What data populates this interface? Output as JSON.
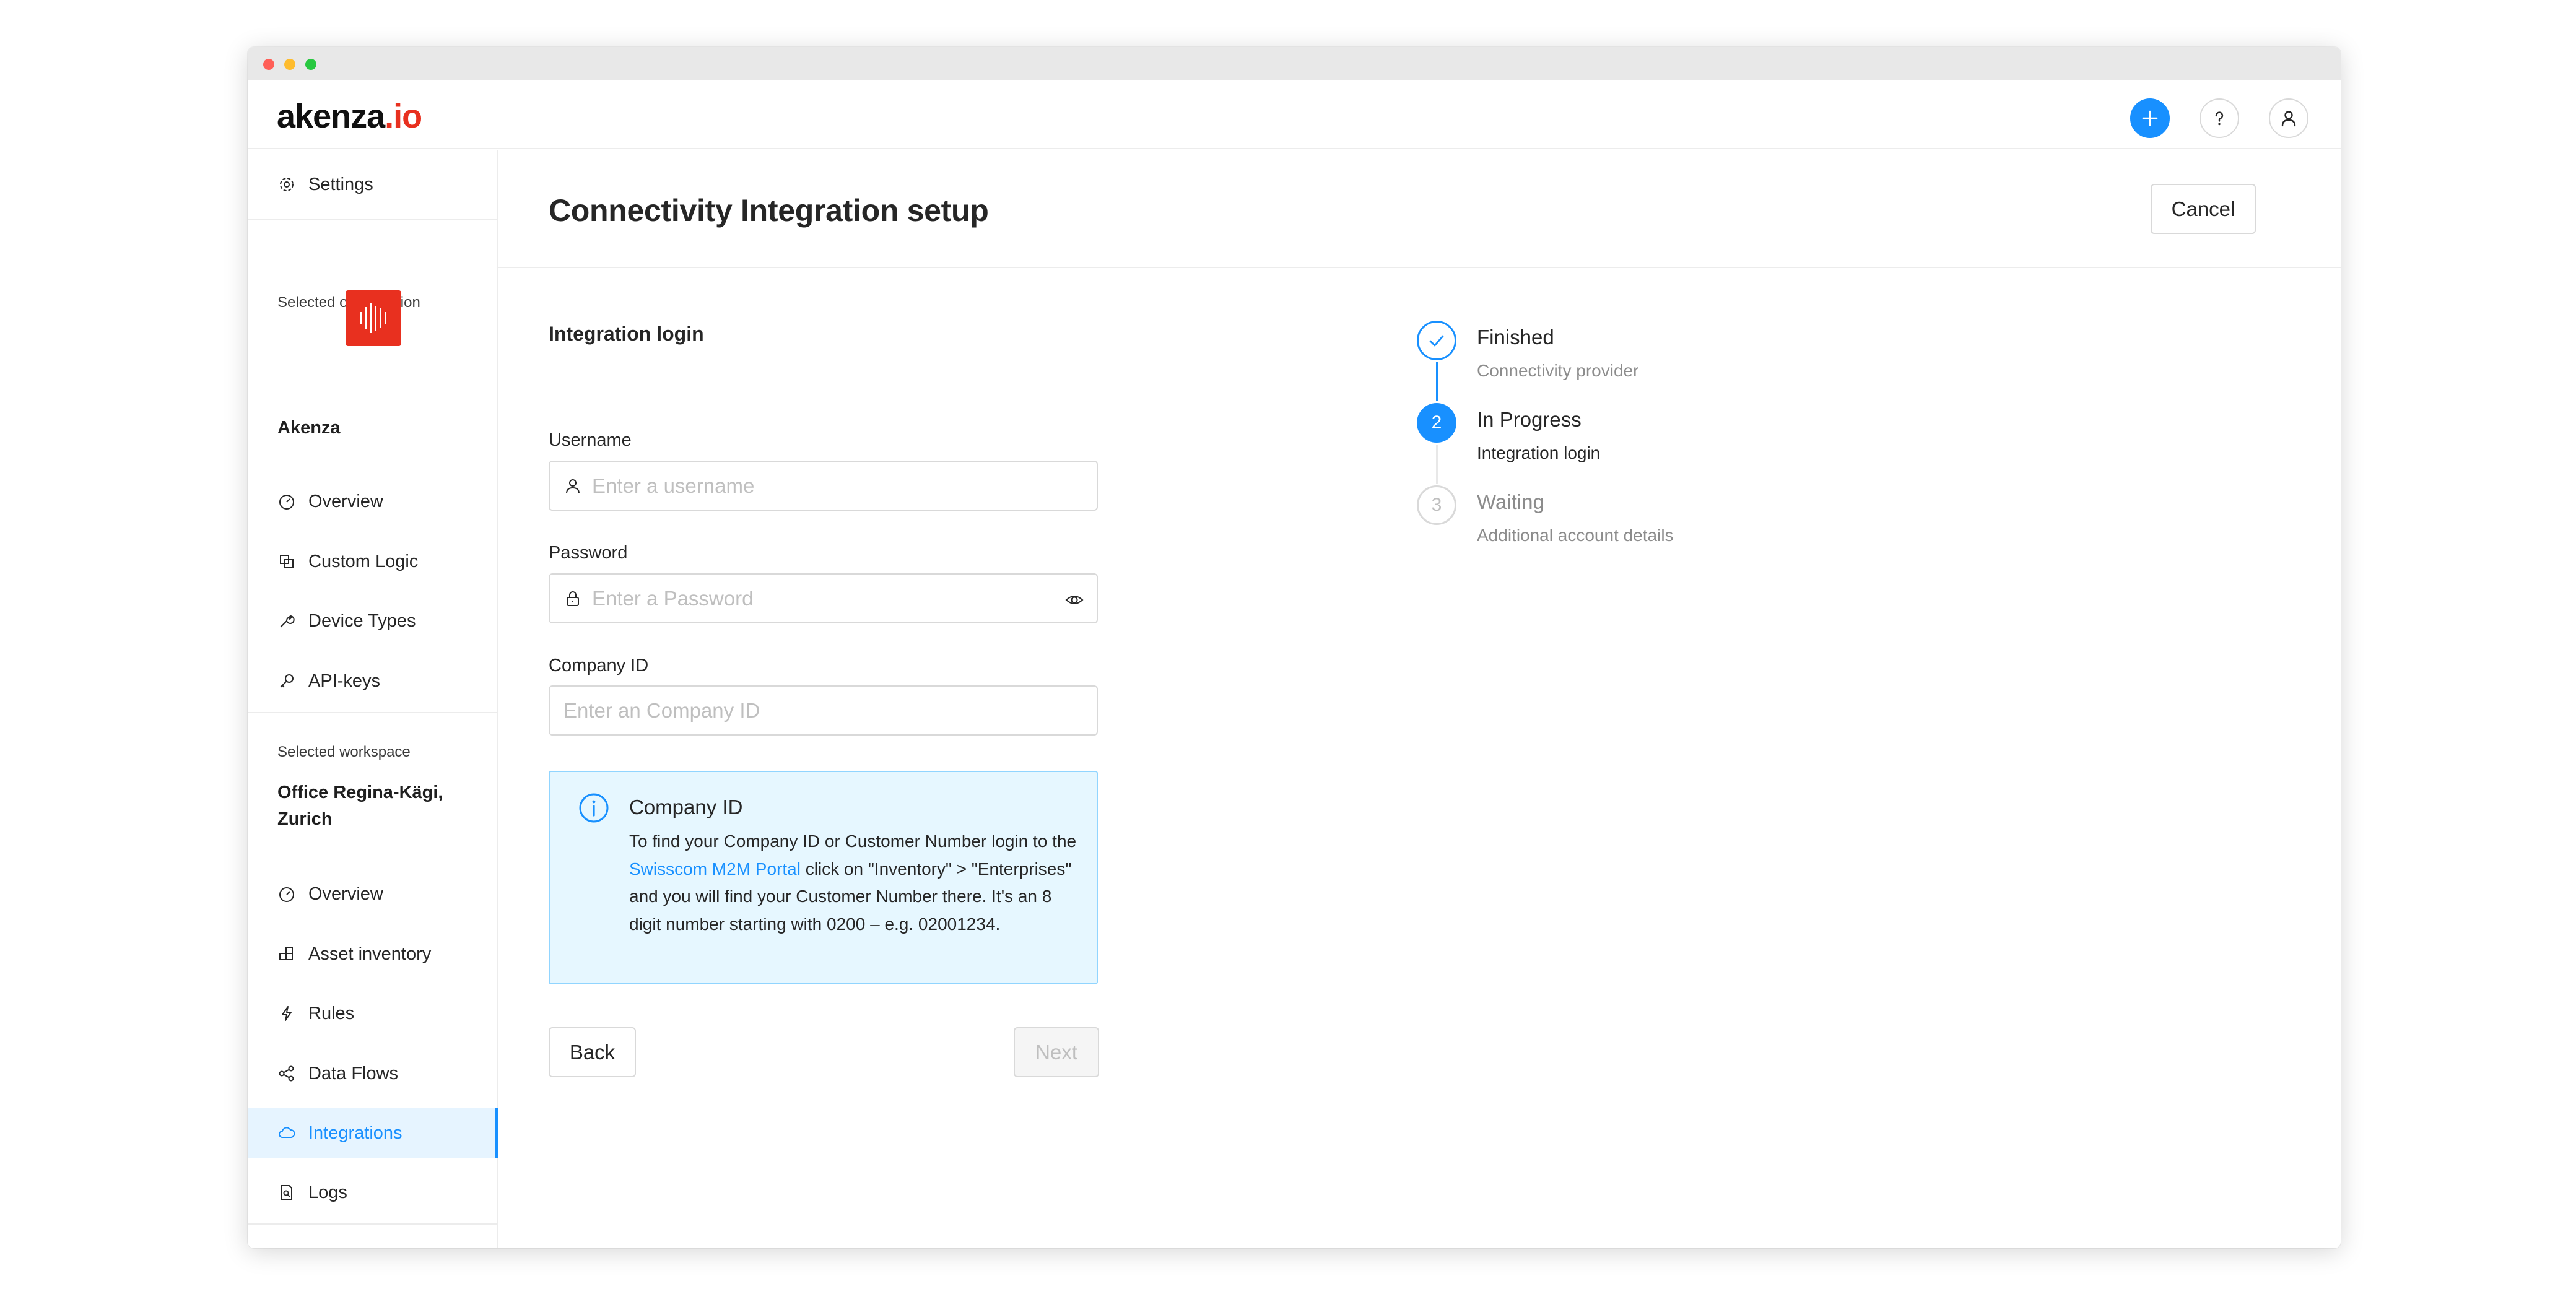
{
  "app": {
    "logo_main": "akenza",
    "logo_tld": ".io"
  },
  "sidebar": {
    "settings_label": "Settings",
    "org_section_label": "Selected organization",
    "org_name": "Akenza",
    "org_items": [
      {
        "label": "Overview",
        "icon": "dashboard-icon"
      },
      {
        "label": "Custom Logic",
        "icon": "copy-icon"
      },
      {
        "label": "Device Types",
        "icon": "tool-icon"
      },
      {
        "label": "API-keys",
        "icon": "key-icon"
      }
    ],
    "workspace_section_label": "Selected workspace",
    "workspace_name": "Office Regina-Kägi, Zurich",
    "workspace_items": [
      {
        "label": "Overview",
        "icon": "dashboard-icon"
      },
      {
        "label": "Asset inventory",
        "icon": "blocks-icon"
      },
      {
        "label": "Rules",
        "icon": "thunderbolt-icon"
      },
      {
        "label": "Data Flows",
        "icon": "share-icon"
      },
      {
        "label": "Integrations",
        "icon": "cloud-icon",
        "active": true
      },
      {
        "label": "Logs",
        "icon": "file-search-icon"
      }
    ]
  },
  "header": {
    "title": "Connectivity Integration setup",
    "cancel_label": "Cancel"
  },
  "form": {
    "section_title": "Integration login",
    "username_label": "Username",
    "username_placeholder": "Enter a username",
    "password_label": "Password",
    "password_placeholder": "Enter a Password",
    "company_label": "Company ID",
    "company_placeholder": "Enter an Company ID",
    "back_label": "Back",
    "next_label": "Next"
  },
  "info": {
    "title": "Company ID",
    "body_before": "To find your Company ID or Customer Number login to the ",
    "link_text": "Swisscom M2M Portal",
    "body_after": " click on \"Inventory\" > \"Enterprises\" and you will find your Customer Number there. It's an 8 digit number starting with 0200 – e.g. 02001234."
  },
  "steps": [
    {
      "status": "Finished",
      "description": "Connectivity provider",
      "number": "1",
      "state": "done"
    },
    {
      "status": "In Progress",
      "description": "Integration login",
      "number": "2",
      "state": "active"
    },
    {
      "status": "Waiting",
      "description": "Additional account details",
      "number": "3",
      "state": "wait"
    }
  ],
  "colors": {
    "primary": "#1890ff",
    "brand_red": "#e8301f",
    "info_bg": "#e6f7ff"
  }
}
